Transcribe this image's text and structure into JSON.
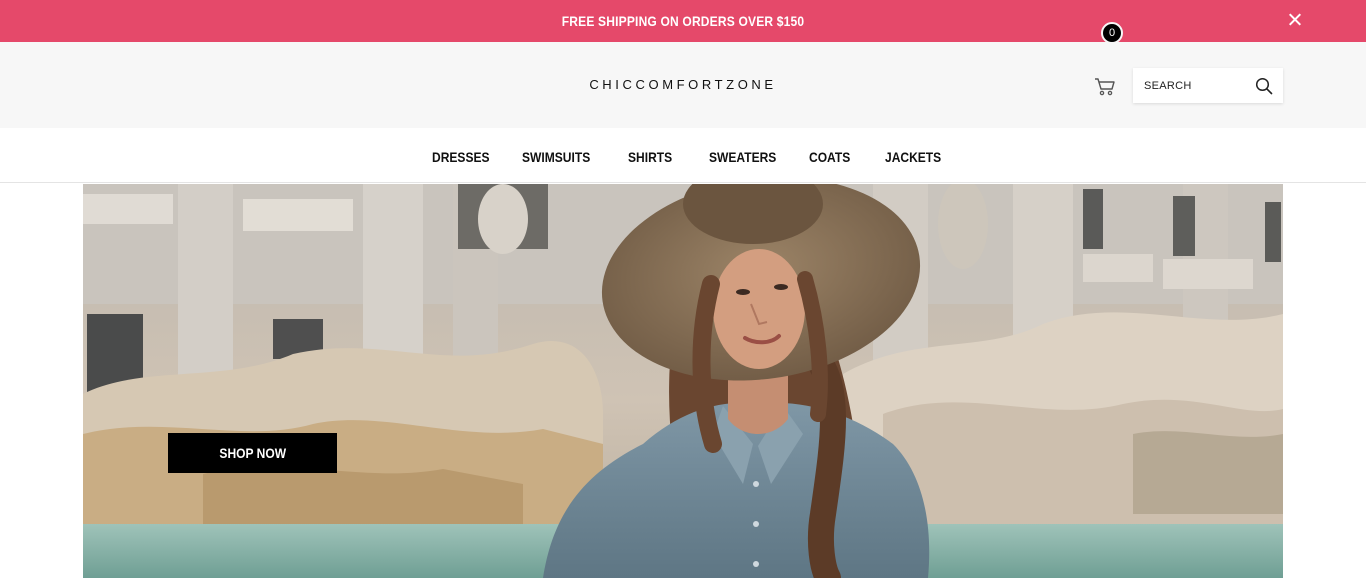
{
  "announcement": {
    "text": "FREE SHIPPING ON ORDERS OVER $150"
  },
  "header": {
    "logo": "CHICCOMFORTZONE",
    "cart_count": "0",
    "search_placeholder": "SEARCH"
  },
  "nav": {
    "items": [
      {
        "label": "DRESSES"
      },
      {
        "label": "SWIMSUITS"
      },
      {
        "label": "SHIRTS"
      },
      {
        "label": "SWEATERS"
      },
      {
        "label": "COATS"
      },
      {
        "label": "JACKETS"
      }
    ]
  },
  "hero": {
    "cta_label": "SHOP NOW"
  },
  "colors": {
    "announcement_bg": "#e5496a",
    "header_bg": "#f7f7f7",
    "cta_bg": "#000000"
  },
  "icons": [
    "close-icon",
    "cart-icon",
    "search-icon"
  ]
}
